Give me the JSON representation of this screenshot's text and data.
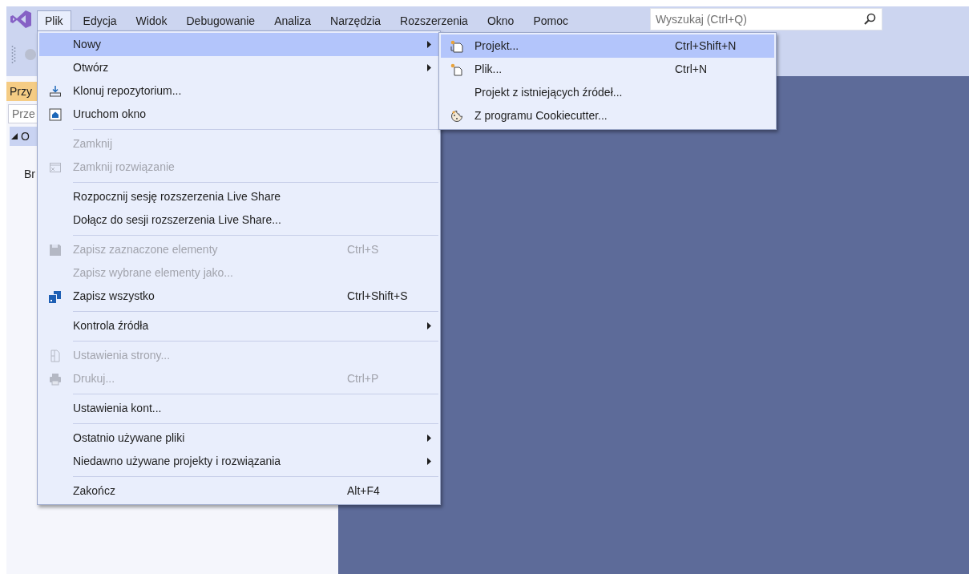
{
  "menu_bar": {
    "items": [
      {
        "label": "Plik",
        "selected": true
      },
      {
        "label": "Edycja",
        "selected": false
      },
      {
        "label": "Widok",
        "selected": false
      },
      {
        "label": "Debugowanie",
        "selected": false
      },
      {
        "label": "Analiza",
        "selected": false
      },
      {
        "label": "Narzędzia",
        "selected": false
      },
      {
        "label": "Rozszerzenia",
        "selected": false
      },
      {
        "label": "Okno",
        "selected": false
      },
      {
        "label": "Pomoc",
        "selected": false
      }
    ]
  },
  "search": {
    "placeholder": "Wyszukaj (Ctrl+Q)"
  },
  "side_panel": {
    "tab": "Przy",
    "search_placeholder": "Prze",
    "tree_item": {
      "label": "O",
      "expanded": true
    },
    "lines": [
      "Br"
    ]
  },
  "file_menu": {
    "items": [
      {
        "kind": "item",
        "label": "Nowy",
        "submenu": true,
        "disabled": false,
        "selected": true
      },
      {
        "kind": "item",
        "label": "Otwórz",
        "submenu": true,
        "disabled": false,
        "selected": false
      },
      {
        "kind": "item",
        "label": "Klonuj repozytorium...",
        "disabled": false,
        "selected": false
      },
      {
        "kind": "item",
        "label": "Uruchom okno",
        "disabled": false,
        "selected": false
      },
      {
        "kind": "separator"
      },
      {
        "kind": "item",
        "label": "Zamknij",
        "disabled": true,
        "selected": false
      },
      {
        "kind": "item",
        "label": "Zamknij rozwiązanie",
        "disabled": true,
        "selected": false
      },
      {
        "kind": "separator"
      },
      {
        "kind": "item",
        "label": "Rozpocznij sesję rozszerzenia Live Share",
        "disabled": false,
        "selected": false
      },
      {
        "kind": "item",
        "label": "Dołącz do sesji rozszerzenia Live Share...",
        "disabled": false,
        "selected": false
      },
      {
        "kind": "separator"
      },
      {
        "kind": "item",
        "label": "Zapisz zaznaczone elementy",
        "shortcut": "Ctrl+S",
        "disabled": true,
        "selected": false
      },
      {
        "kind": "item",
        "label": "Zapisz wybrane elementy jako...",
        "disabled": true,
        "selected": false
      },
      {
        "kind": "item",
        "label": "Zapisz wszystko",
        "shortcut": "Ctrl+Shift+S",
        "disabled": false,
        "selected": false
      },
      {
        "kind": "separator"
      },
      {
        "kind": "item",
        "label": "Kontrola źródła",
        "submenu": true,
        "disabled": false,
        "selected": false
      },
      {
        "kind": "separator"
      },
      {
        "kind": "item",
        "label": "Ustawienia strony...",
        "disabled": true,
        "selected": false
      },
      {
        "kind": "item",
        "label": "Drukuj...",
        "shortcut": "Ctrl+P",
        "disabled": true,
        "selected": false
      },
      {
        "kind": "separator"
      },
      {
        "kind": "item",
        "label": "Ustawienia kont...",
        "disabled": false,
        "selected": false
      },
      {
        "kind": "separator"
      },
      {
        "kind": "item",
        "label": "Ostatnio używane pliki",
        "submenu": true,
        "disabled": false,
        "selected": false
      },
      {
        "kind": "item",
        "label": "Niedawno używane projekty i rozwiązania",
        "submenu": true,
        "disabled": false,
        "selected": false
      },
      {
        "kind": "separator"
      },
      {
        "kind": "item",
        "label": "Zakończ",
        "shortcut": "Alt+F4",
        "disabled": false,
        "selected": false
      }
    ]
  },
  "new_submenu": {
    "items": [
      {
        "label": "Projekt...",
        "shortcut": "Ctrl+Shift+N",
        "selected": true
      },
      {
        "label": "Plik...",
        "shortcut": "Ctrl+N",
        "selected": false
      },
      {
        "label": "Projekt z istniejących źródeł...",
        "selected": false
      },
      {
        "label": "Z programu Cookiecutter...",
        "selected": false
      }
    ]
  }
}
